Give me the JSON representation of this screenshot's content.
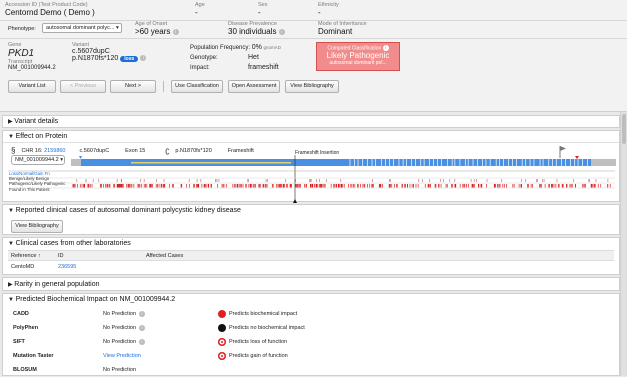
{
  "header": {
    "accession_label": "Accession ID (Test Product Code)",
    "accession_value": "Centornd Demo  ( Demo )",
    "age_label": "Age",
    "age_value": "-",
    "sex_label": "Sex",
    "sex_value": "-",
    "ethnicity_label": "Ethnicity",
    "ethnicity_value": "-"
  },
  "phenotype": {
    "label": "Phenotype:",
    "value": "autosomal dominant polyc...  ▾",
    "onset_label": "Age of Onset",
    "onset_value": ">60 years",
    "prevalence_label": "Disease Prevalence",
    "prevalence_value": "30 individuals",
    "inheritance_label": "Mode of Inheritance",
    "inheritance_value": "Dominant"
  },
  "variant": {
    "gene_label": "Gene",
    "gene_value": "PKD1",
    "transcript_label": "Transcript",
    "transcript_value": "NM_001009944.2",
    "variant_label": "Variant",
    "cdna": "c.5607dupC",
    "protein": "p.N1870fs*120",
    "loss_badge": "loss",
    "popfreq_label": "Population Frequency:",
    "popfreq_value": "0%",
    "popfreq_src": "gnomAD",
    "genotype_label": "Genotype:",
    "genotype_value": "Het",
    "impact_label": "Impact:",
    "impact_value": "frameshift",
    "classification_title": "Computed Classification",
    "classification_value": "Likely Pathogenic",
    "classification_sub": "autosomal dominant pol..."
  },
  "toolbar": {
    "variant_list": "Variant List",
    "previous": "< Previous",
    "next": "Next >",
    "use_classification": "Use Classification",
    "open_assessment": "Open Assessment",
    "view_bibliography": "View Bibliography"
  },
  "sections": {
    "variant_details": "Variant details",
    "effect": "Effect on Protein",
    "reported": "Reported clinical cases of autosomal dominant polycystic kidney disease",
    "clinical_cases": "Clinical cases from other laboratories",
    "rarity": "Rarity in general population",
    "predicted": "Predicted Biochemical Impact on NM_001009944.2"
  },
  "effect": {
    "chr": "CHR 16:",
    "chr_pos": "2159860",
    "cdna": "c.5607dupC",
    "exon": "Exon 15",
    "protein": "p.N1870fs*120",
    "impact": "Frameshift",
    "transcript_select": "NM_001009944.2  ▾",
    "marker_label": "Frameshift Insertion",
    "track_lossnormal": "Loss/Normal/Gain Fn",
    "track_benign": "Benign/Likely Benign",
    "track_path": "Pathogenic/Likely Pathogenic",
    "track_found": "Found in This Patient"
  },
  "reported": {
    "button": "View Bibliography"
  },
  "clinical": {
    "col_ref": "Reference ↑",
    "col_id": "ID",
    "col_cases": "Affected Cases",
    "row_ref": "CentoMD",
    "row_id": "236595"
  },
  "predictions": [
    {
      "tool": "CADD",
      "value": "No Prediction",
      "link": false
    },
    {
      "tool": "PolyPhen",
      "value": "No Prediction",
      "link": false
    },
    {
      "tool": "SIFT",
      "value": "No Prediction",
      "link": false
    },
    {
      "tool": "Mutation Taster",
      "value": "View Prediction",
      "link": true
    },
    {
      "tool": "BLOSUM",
      "value": "No Prediction",
      "link": false
    }
  ],
  "legend": [
    {
      "label": "Predicts biochemical impact",
      "color": "#e02020",
      "ring": false
    },
    {
      "label": "Predicts no biochemical impact",
      "color": "#111111",
      "ring": false
    },
    {
      "label": "Predicts loss of function",
      "color": "#e02020",
      "ring": true
    },
    {
      "label": "Predicts gain of function",
      "color": "#e02020",
      "ring": true
    }
  ],
  "colors": {
    "accent": "#1a6ed8",
    "classification_bg": "#f28b8b",
    "protein_bar": "#4a90e2",
    "pathogenic": "#d21f1f"
  }
}
